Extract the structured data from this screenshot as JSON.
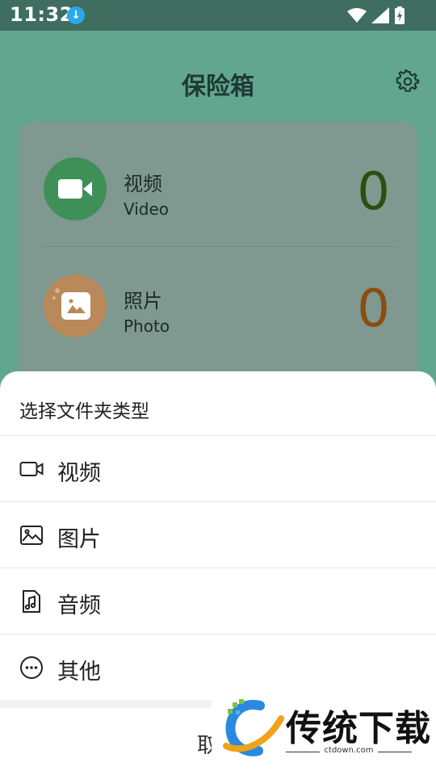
{
  "status_bar": {
    "time": "11:32",
    "icons": [
      "download-icon",
      "wifi-icon",
      "signal-icon",
      "battery-charging-icon"
    ]
  },
  "app": {
    "title": "保险箱",
    "settings_icon": "gear-icon",
    "vault_items": [
      {
        "name": "视频",
        "subtitle": "Video",
        "count": "0",
        "icon": "video-camera-icon",
        "icon_color": "#3f8f58",
        "count_color": "#2e4e10"
      },
      {
        "name": "照片",
        "subtitle": "Photo",
        "count": "0",
        "icon": "photo-icon",
        "icon_color": "#b9895a",
        "count_color": "#8a4d10"
      }
    ]
  },
  "sheet": {
    "title": "选择文件夹类型",
    "options": [
      {
        "label": "视频",
        "icon": "video-icon"
      },
      {
        "label": "图片",
        "icon": "image-icon"
      },
      {
        "label": "音频",
        "icon": "audio-file-icon"
      },
      {
        "label": "其他",
        "icon": "more-circle-icon"
      }
    ],
    "cancel_label": "取消"
  },
  "watermark": {
    "text": "传统下载",
    "url": "ctdown.com"
  }
}
